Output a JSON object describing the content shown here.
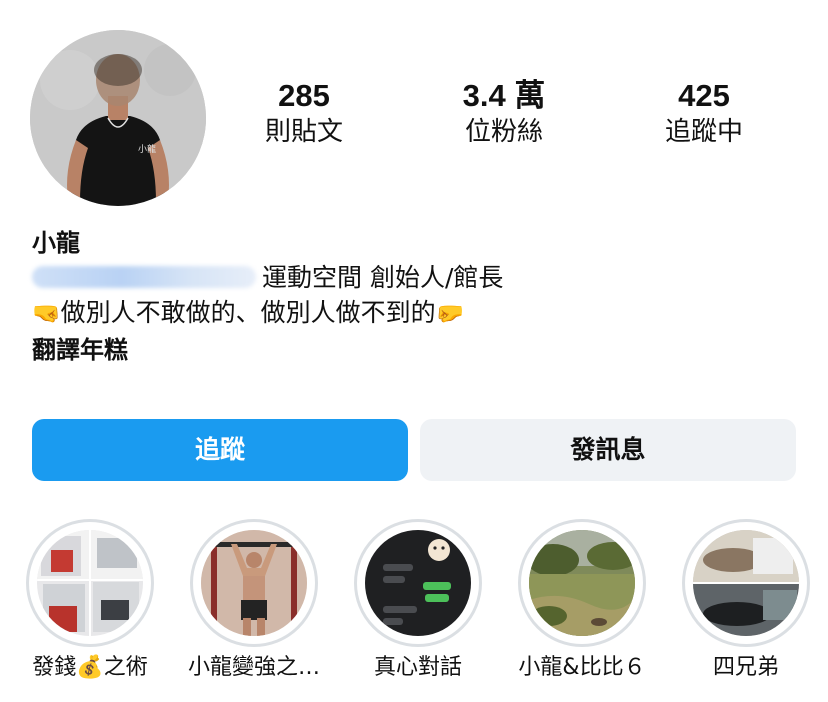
{
  "profile": {
    "avatar_icon": "profile-avatar",
    "stats": [
      {
        "value": "285",
        "label": "則貼文"
      },
      {
        "value": "3.4 萬",
        "label": "位粉絲"
      },
      {
        "value": "425",
        "label": "追蹤中"
      }
    ]
  },
  "bio": {
    "name": "小龍",
    "line1": "運動空間 創始人/館長",
    "line2_left_emoji": "🤜",
    "line2_text": "做別人不敢做的、做別人做不到的",
    "line2_right_emoji": "🤛",
    "line3": "翻譯年糕"
  },
  "buttons": {
    "follow": "追蹤",
    "message": "發訊息"
  },
  "highlights": [
    {
      "label": "發錢💰之術"
    },
    {
      "label": "小龍變強之…"
    },
    {
      "label": "真心對話"
    },
    {
      "label": "小龍&比比６"
    },
    {
      "label": "四兄弟"
    }
  ],
  "colors": {
    "follow_button": "#1a9bf0",
    "message_button": "#eff2f5",
    "highlight_ring": "#dbdfe3"
  }
}
